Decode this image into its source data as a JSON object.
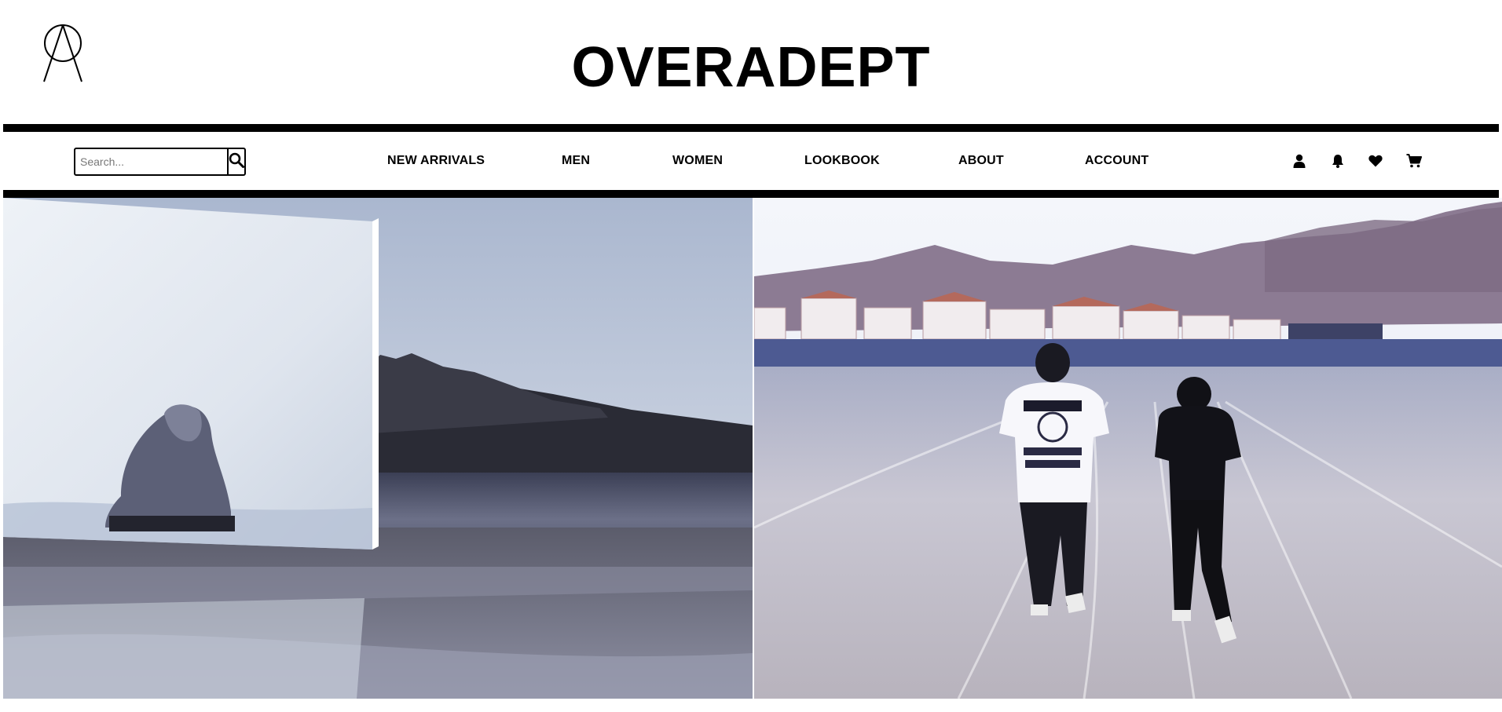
{
  "brand": {
    "name": "OVERADEPT",
    "logo_icon": "compass-a-logo-icon"
  },
  "search": {
    "placeholder": "Search...",
    "value": "",
    "button_icon": "search-icon"
  },
  "nav": {
    "items": [
      {
        "label": "NEW ARRIVALS"
      },
      {
        "label": "MEN"
      },
      {
        "label": "WOMEN"
      },
      {
        "label": "LOOKBOOK"
      },
      {
        "label": "ABOUT"
      },
      {
        "label": "ACCOUNT"
      }
    ]
  },
  "utility_icons": [
    "user-icon",
    "bell-icon",
    "heart-icon",
    "cart-icon"
  ],
  "hero": {
    "left_image": "person-beside-mirror-on-beach-photo",
    "right_image": "two-people-walking-on-dirt-field-photo"
  },
  "colors": {
    "text": "#000000",
    "background": "#ffffff"
  }
}
